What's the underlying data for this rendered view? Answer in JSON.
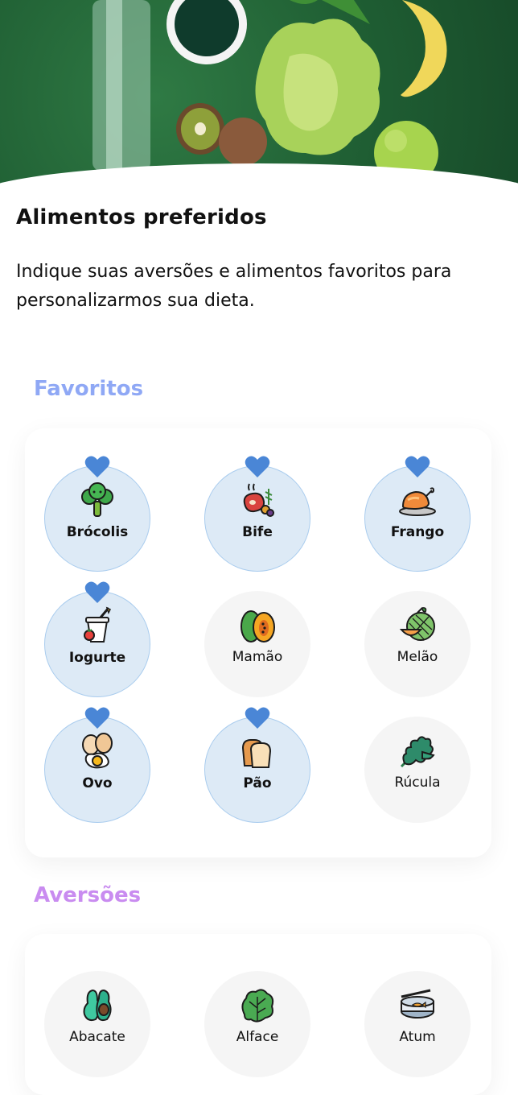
{
  "page": {
    "title": "Alimentos preferidos",
    "description": "Indique suas aversões e alimentos favoritos para personalizarmos sua dieta."
  },
  "colors": {
    "favorites_label": "#8fa8f5",
    "aversions_label": "#c98cf0",
    "selected_bg": "#ddeaf6",
    "heart": "#4a86d6"
  },
  "favorites": {
    "label": "Favoritos",
    "items": [
      {
        "label": "Brócolis",
        "selected": true,
        "icon": "broccoli-icon"
      },
      {
        "label": "Bife",
        "selected": true,
        "icon": "steak-icon"
      },
      {
        "label": "Frango",
        "selected": true,
        "icon": "roast-chicken-icon"
      },
      {
        "label": "Iogurte",
        "selected": true,
        "icon": "yogurt-icon"
      },
      {
        "label": "Mamão",
        "selected": false,
        "icon": "papaya-icon"
      },
      {
        "label": "Melão",
        "selected": false,
        "icon": "melon-icon"
      },
      {
        "label": "Ovo",
        "selected": true,
        "icon": "egg-icon"
      },
      {
        "label": "Pão",
        "selected": true,
        "icon": "bread-icon"
      },
      {
        "label": "Rúcula",
        "selected": false,
        "icon": "arugula-icon"
      }
    ]
  },
  "aversions": {
    "label": "Aversões",
    "items": [
      {
        "label": "Abacate",
        "selected": false,
        "icon": "avocado-icon"
      },
      {
        "label": "Alface",
        "selected": false,
        "icon": "lettuce-icon"
      },
      {
        "label": "Atum",
        "selected": false,
        "icon": "tuna-can-icon"
      }
    ]
  }
}
